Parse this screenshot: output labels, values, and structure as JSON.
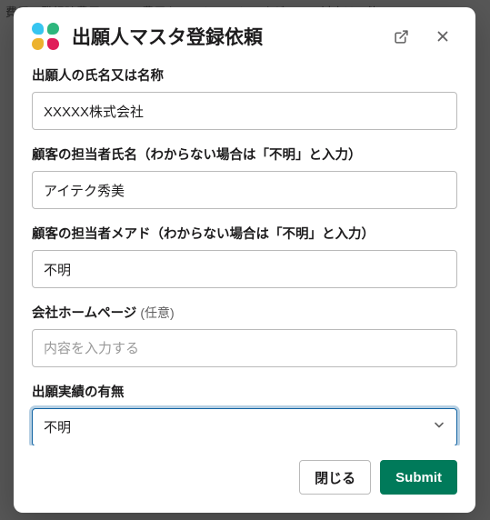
{
  "modal": {
    "title": "出願人マスタ登録依頼",
    "fields": {
      "applicant_name": {
        "label": "出願人の氏名又は名称",
        "value": "XXXXX株式会社"
      },
      "contact_name": {
        "label": "顧客の担当者氏名（わからない場合は「不明」と入力）",
        "value": "アイテク秀美"
      },
      "contact_email": {
        "label": "顧客の担当者メアド（わからない場合は「不明」と入力）",
        "value": "不明"
      },
      "homepage": {
        "label": "会社ホームページ",
        "optional": "(任意)",
        "placeholder": "内容を入力する",
        "value": ""
      },
      "filing_history": {
        "label": "出願実績の有無",
        "selected": "不明"
      }
    },
    "buttons": {
      "close": "閉じる",
      "submit": "Submit"
    }
  },
  "background_text": "費用・登録時費用」のIPT費用を... いとのことですが、この対応は可能で"
}
